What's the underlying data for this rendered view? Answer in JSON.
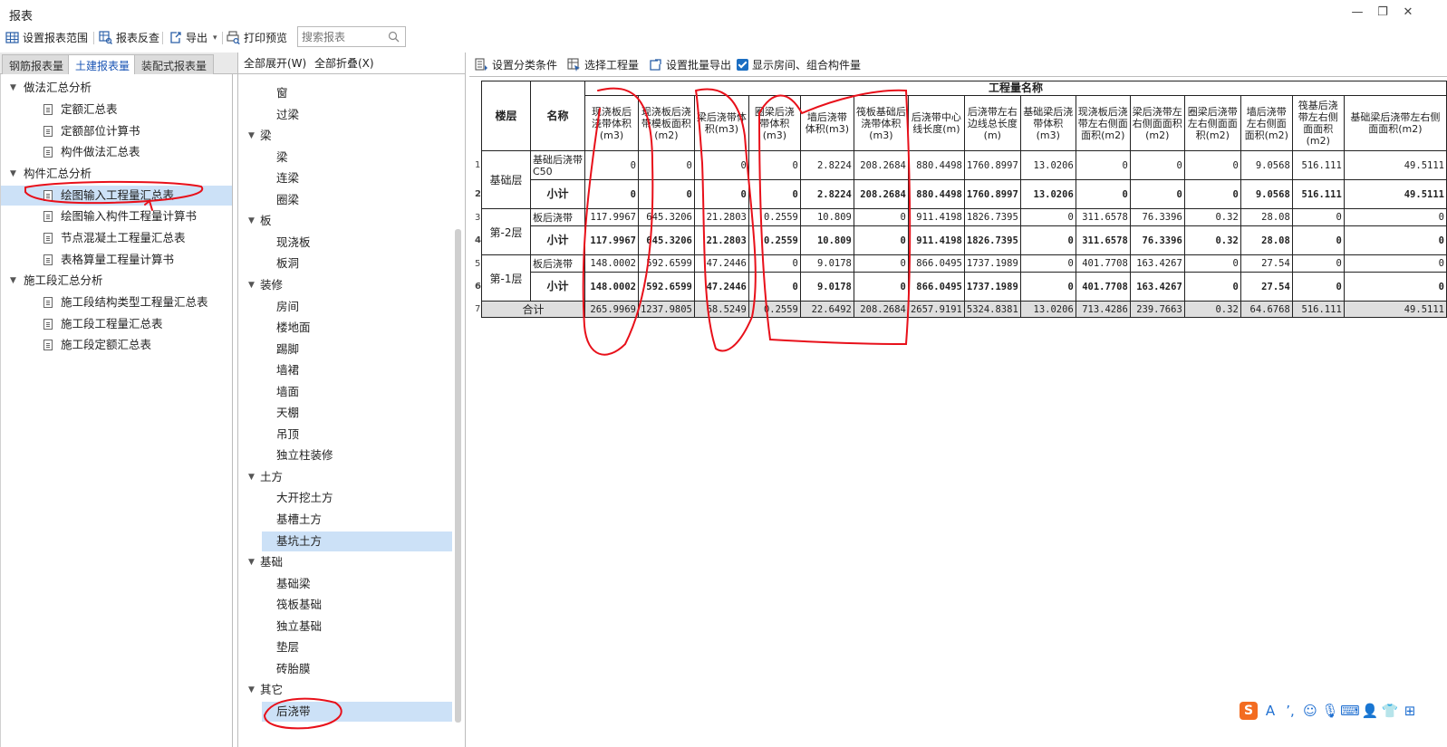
{
  "window": {
    "title": "报表",
    "controls": {
      "minimize": "—",
      "restore": "❐",
      "close": "✕"
    }
  },
  "toolbar": {
    "set_range": "设置报表范围",
    "reverse_check": "报表反查",
    "export": "导出",
    "export_arrow": "▾",
    "print_preview": "打印预览",
    "search_placeholder": "搜索报表"
  },
  "tabs": {
    "rebar": "钢筋报表量",
    "civil": "土建报表量",
    "prefab": "装配式报表量"
  },
  "left_tree": {
    "groups": [
      {
        "label": "做法汇总分析",
        "items": [
          "定额汇总表",
          "定额部位计算书",
          "构件做法汇总表"
        ]
      },
      {
        "label": "构件汇总分析",
        "items": [
          "绘图输入工程量汇总表",
          "绘图输入构件工程量计算书",
          "节点混凝土工程量汇总表",
          "表格算量工程量计算书"
        ]
      },
      {
        "label": "施工段汇总分析",
        "items": [
          "施工段结构类型工程量汇总表",
          "施工段工程量汇总表",
          "施工段定额汇总表"
        ]
      }
    ],
    "selected": "绘图输入工程量汇总表"
  },
  "middle": {
    "expand_all": "全部展开(W)",
    "collapse_all": "全部折叠(X)",
    "rows": [
      {
        "type": "leaf",
        "label": "窗"
      },
      {
        "type": "leaf",
        "label": "过梁"
      },
      {
        "type": "group",
        "label": "梁"
      },
      {
        "type": "leaf",
        "label": "梁"
      },
      {
        "type": "leaf",
        "label": "连梁"
      },
      {
        "type": "leaf",
        "label": "圈梁"
      },
      {
        "type": "group",
        "label": "板"
      },
      {
        "type": "leaf",
        "label": "现浇板"
      },
      {
        "type": "leaf",
        "label": "板洞"
      },
      {
        "type": "group",
        "label": "装修"
      },
      {
        "type": "leaf",
        "label": "房间"
      },
      {
        "type": "leaf",
        "label": "楼地面"
      },
      {
        "type": "leaf",
        "label": "踢脚"
      },
      {
        "type": "leaf",
        "label": "墙裙"
      },
      {
        "type": "leaf",
        "label": "墙面"
      },
      {
        "type": "leaf",
        "label": "天棚"
      },
      {
        "type": "leaf",
        "label": "吊顶"
      },
      {
        "type": "leaf",
        "label": "独立柱装修"
      },
      {
        "type": "group",
        "label": "土方"
      },
      {
        "type": "leaf",
        "label": "大开挖土方"
      },
      {
        "type": "leaf",
        "label": "基槽土方"
      },
      {
        "type": "leaf",
        "label": "基坑土方",
        "highlight": true
      },
      {
        "type": "group",
        "label": "基础"
      },
      {
        "type": "leaf",
        "label": "基础梁"
      },
      {
        "type": "leaf",
        "label": "筏板基础"
      },
      {
        "type": "leaf",
        "label": "独立基础"
      },
      {
        "type": "leaf",
        "label": "垫层"
      },
      {
        "type": "leaf",
        "label": "砖胎膜"
      },
      {
        "type": "group",
        "label": "其它"
      },
      {
        "type": "leaf",
        "label": "后浇带",
        "highlight": true
      }
    ]
  },
  "right_toolbar": {
    "set_category": "设置分类条件",
    "select_qty": "选择工程量",
    "batch_export": "设置批量导出",
    "show_rooms": "显示房间、组合构件量"
  },
  "report": {
    "group_header": "工程量名称",
    "floor_header": "楼层",
    "name_header": "名称",
    "columns": [
      "现浇板后浇带体积(m3)",
      "现浇板后浇带模板面积(m2)",
      "梁后浇带体积(m3)",
      "圈梁后浇带体积(m3)",
      "墙后浇带体积(m3)",
      "筏板基础后浇带体积(m3)",
      "后浇带中心线长度(m)",
      "后浇带左右边线总长度(m)",
      "基础梁后浇带体积(m3)",
      "现浇板后浇带左右侧面面积(m2)",
      "梁后浇带左右侧面面积(m2)",
      "圈梁后浇带左右侧面面积(m2)",
      "墙后浇带左右侧面面积(m2)",
      "筏基后浇带左右侧面面积(m2)",
      "基础梁后浇带左右侧面面积(m2)"
    ],
    "floors": [
      {
        "floor": "基础层",
        "rows": [
          {
            "no": "1",
            "name": "基础后浇带C50",
            "values": [
              "0",
              "0",
              "0",
              "0",
              "2.8224",
              "208.2684",
              "880.4498",
              "1760.8997",
              "13.0206",
              "0",
              "0",
              "0",
              "9.0568",
              "516.111",
              "49.5111"
            ]
          },
          {
            "no": "2",
            "name": "小计",
            "subtotal": true,
            "values": [
              "0",
              "0",
              "0",
              "0",
              "2.8224",
              "208.2684",
              "880.4498",
              "1760.8997",
              "13.0206",
              "0",
              "0",
              "0",
              "9.0568",
              "516.111",
              "49.5111"
            ]
          }
        ]
      },
      {
        "floor": "第-2层",
        "rows": [
          {
            "no": "3",
            "name": "板后浇带",
            "values": [
              "117.9967",
              "645.3206",
              "21.2803",
              "0.2559",
              "10.809",
              "0",
              "911.4198",
              "1826.7395",
              "0",
              "311.6578",
              "76.3396",
              "0.32",
              "28.08",
              "0",
              "0"
            ]
          },
          {
            "no": "4",
            "name": "小计",
            "subtotal": true,
            "values": [
              "117.9967",
              "645.3206",
              "21.2803",
              "0.2559",
              "10.809",
              "0",
              "911.4198",
              "1826.7395",
              "0",
              "311.6578",
              "76.3396",
              "0.32",
              "28.08",
              "0",
              "0"
            ]
          }
        ]
      },
      {
        "floor": "第-1层",
        "rows": [
          {
            "no": "5",
            "name": "板后浇带",
            "values": [
              "148.0002",
              "592.6599",
              "47.2446",
              "0",
              "9.0178",
              "0",
              "866.0495",
              "1737.1989",
              "0",
              "401.7708",
              "163.4267",
              "0",
              "27.54",
              "0",
              "0"
            ]
          },
          {
            "no": "6",
            "name": "小计",
            "subtotal": true,
            "values": [
              "148.0002",
              "592.6599",
              "47.2446",
              "0",
              "9.0178",
              "0",
              "866.0495",
              "1737.1989",
              "0",
              "401.7708",
              "163.4267",
              "0",
              "27.54",
              "0",
              "0"
            ]
          }
        ]
      }
    ],
    "total": {
      "no": "7",
      "label": "合计",
      "values": [
        "265.9969",
        "1237.9805",
        "68.5249",
        "0.2559",
        "22.6492",
        "208.2684",
        "2657.9191",
        "5324.8381",
        "13.0206",
        "713.4286",
        "239.7663",
        "0.32",
        "64.6768",
        "516.111",
        "49.5111"
      ]
    }
  },
  "ime": [
    "S",
    "A",
    "’,",
    "☺",
    "🎙",
    "⌨",
    "👤",
    "👕",
    "⊞"
  ],
  "colors": {
    "accent": "#1a55b5",
    "selection": "#cce1f7",
    "annotation": "#e8101a"
  }
}
